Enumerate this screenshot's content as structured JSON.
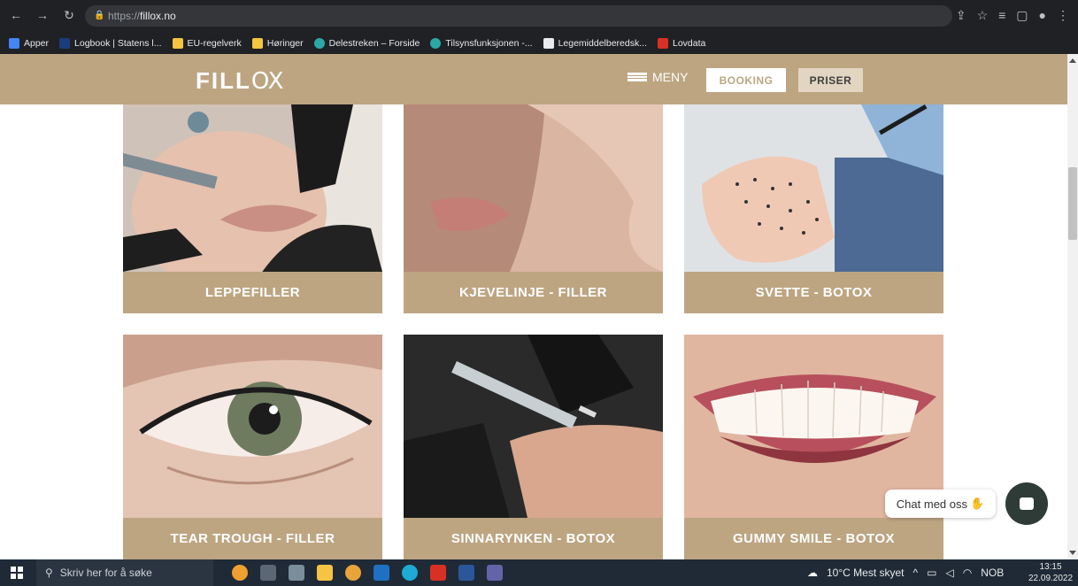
{
  "browser": {
    "url_proto": "https://",
    "url_host": "fillox.no",
    "bookmarks": [
      "Apper",
      "Logbook | Statens l...",
      "EU-regelverk",
      "Høringer",
      "Delestreken – Forside",
      "Tilsynsfunksjonen -...",
      "Legemiddelberedsk...",
      "Lovdata"
    ]
  },
  "header": {
    "logo_main": "FILL",
    "logo_ox": "OX",
    "menu_label": "MENY",
    "booking_label": "BOOKING",
    "priser_label": "PRISER"
  },
  "treatments": [
    {
      "label": "LEPPEFILLER",
      "image": "lips-injection"
    },
    {
      "label": "KJEVELINJE - FILLER",
      "image": "jawline"
    },
    {
      "label": "SVETTE - BOTOX",
      "image": "palm-injection"
    },
    {
      "label": "TEAR TROUGH - FILLER",
      "image": "eye"
    },
    {
      "label": "SINNARYNKEN - BOTOX",
      "image": "syringe-forehead"
    },
    {
      "label": "GUMMY SMILE - BOTOX",
      "image": "smile"
    }
  ],
  "chat": {
    "label": "Chat med oss"
  },
  "taskbar": {
    "search_placeholder": "Skriv her for å søke",
    "weather": "10°C  Mest skyet",
    "lang": "NOB",
    "time": "13:15",
    "date": "22.09.2022"
  },
  "colors": {
    "brand": "#bda582",
    "chat": "#2e3b36"
  }
}
